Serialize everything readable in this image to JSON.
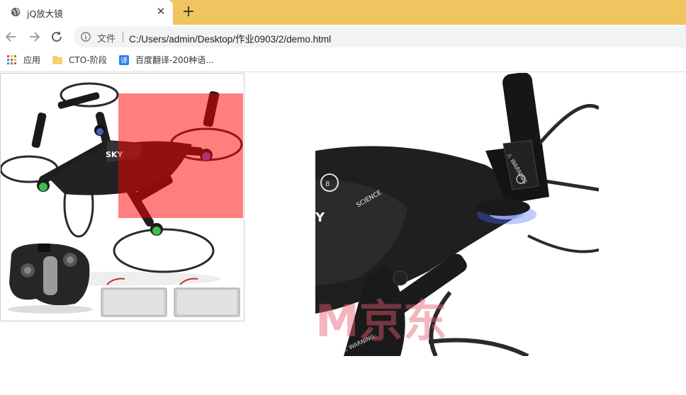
{
  "browser": {
    "tab": {
      "title": "jQ放大镜",
      "close_glyph": "✕",
      "favicon": "globe-icon"
    },
    "new_tab_glyph": "+",
    "toolbar": {
      "back": "back-arrow-icon",
      "forward": "forward-arrow-icon",
      "reload": "reload-icon",
      "address": {
        "protocol_label": "文件",
        "url": "C:/Users/admin/Desktop/作业0903/2/demo.html"
      }
    },
    "bookmarks": [
      {
        "label": "应用",
        "icon": "apps-grid-icon"
      },
      {
        "label": "CTO-阶段",
        "icon": "folder-icon"
      },
      {
        "label": "百度翻译-200种语...",
        "icon": "translate-icon"
      }
    ],
    "colors": {
      "tabstrip": "#f0c45f",
      "lens": "rgba(255,0,0,0.5)"
    }
  },
  "page": {
    "small_image": "drone-product-photo",
    "zoom_image": "drone-zoomed-photo",
    "watermark": "M京东"
  }
}
